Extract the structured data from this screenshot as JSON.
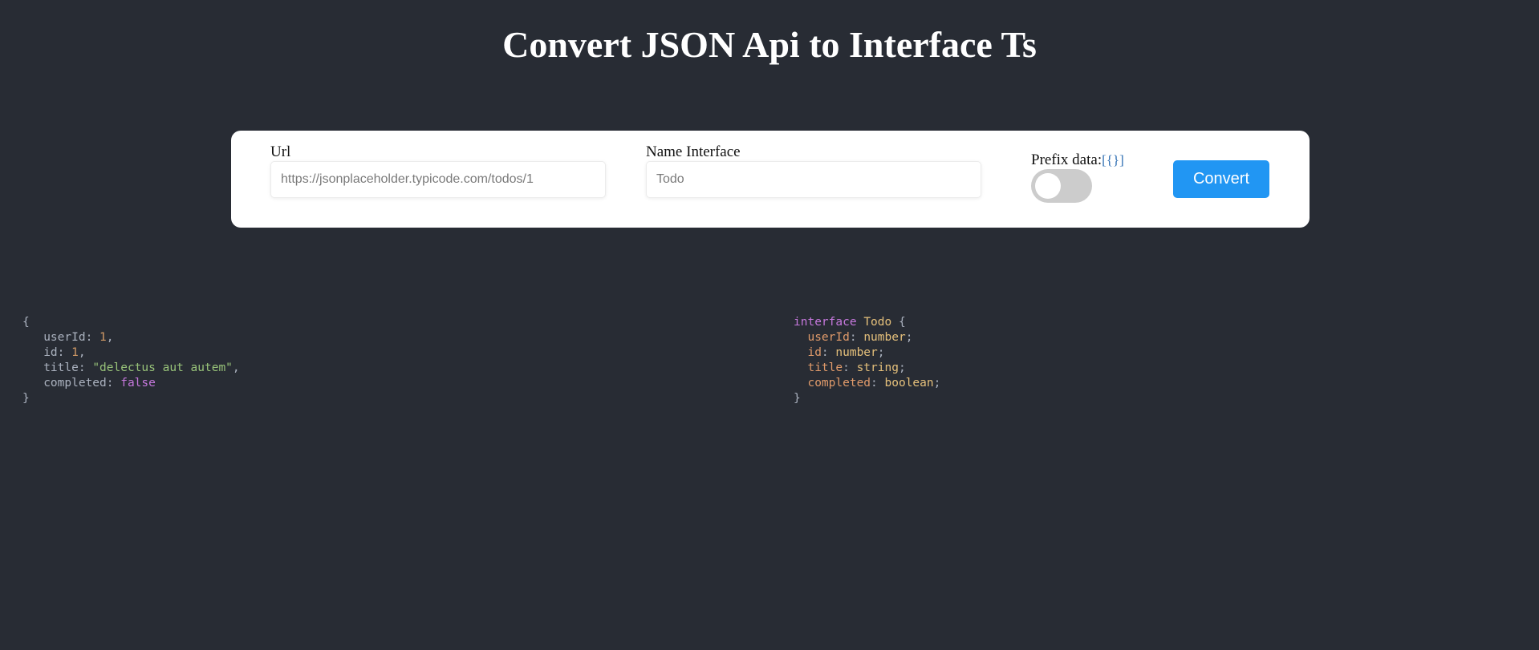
{
  "header": {
    "title": "Convert JSON Api to Interface Ts"
  },
  "form": {
    "url_label": "Url",
    "url_placeholder": "https://jsonplaceholder.typicode.com/todos/1",
    "url_value": "",
    "name_label": "Name Interface",
    "name_placeholder": "Todo",
    "name_value": "",
    "prefix_label": "Prefix data:",
    "prefix_icon": "curly-braces-icon",
    "prefix_icon_glyph": "[{}]",
    "prefix_toggle_on": false,
    "convert_label": "Convert"
  },
  "json_output": {
    "open_brace": "{",
    "close_brace": "}",
    "fields": [
      {
        "key": "userId",
        "value": "1",
        "value_type": "number",
        "trailing": ","
      },
      {
        "key": "id",
        "value": "1",
        "value_type": "number",
        "trailing": ","
      },
      {
        "key": "title",
        "value": "\"delectus aut autem\"",
        "value_type": "string",
        "trailing": ","
      },
      {
        "key": "completed",
        "value": "false",
        "value_type": "boolean",
        "trailing": ""
      }
    ]
  },
  "ts_output": {
    "keyword": "interface",
    "name": "Todo",
    "open_brace": "{",
    "close_brace": "}",
    "fields": [
      {
        "key": "userId",
        "type": "number"
      },
      {
        "key": "id",
        "type": "number"
      },
      {
        "key": "title",
        "type": "string"
      },
      {
        "key": "completed",
        "type": "boolean"
      }
    ]
  },
  "colors": {
    "background": "#282c34",
    "card": "#ffffff",
    "accent": "#2196f3",
    "toggle_off": "#cccccc",
    "code_number": "#d19a66",
    "code_string": "#98c379",
    "code_keyword": "#c678dd",
    "code_type": "#e5c07b"
  }
}
